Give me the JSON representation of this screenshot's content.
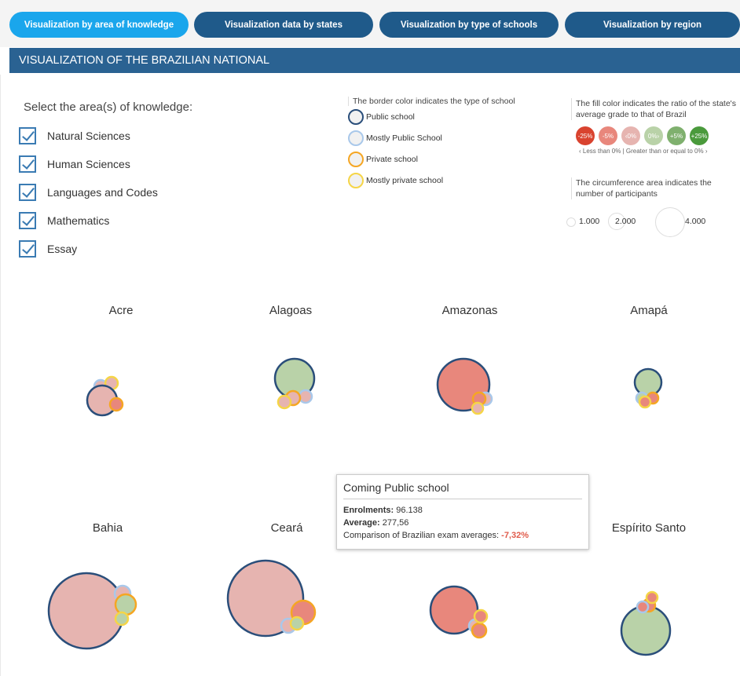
{
  "tabs": [
    {
      "label": "Visualization by area of knowledge",
      "active": true
    },
    {
      "label": "Visualization data by states",
      "active": false
    },
    {
      "label": "Visualization by type of schools",
      "active": false
    },
    {
      "label": "Visualization by region",
      "active": false
    }
  ],
  "banner": {
    "title": "VISUALIZATION OF THE BRAZILIAN NATIONAL"
  },
  "selector": {
    "title": "Select the area(s) of knowledge:",
    "items": [
      {
        "label": "Natural Sciences",
        "checked": true
      },
      {
        "label": "Human Sciences",
        "checked": true
      },
      {
        "label": "Languages and Codes",
        "checked": true
      },
      {
        "label": "Mathematics",
        "checked": true
      },
      {
        "label": "Essay",
        "checked": true
      }
    ]
  },
  "legend_border": {
    "title": "The border color indicates the type of school",
    "items": [
      {
        "label": "Public school",
        "color": "#2a4e7a"
      },
      {
        "label": "Mostly Public School",
        "color": "#a9c8ea"
      },
      {
        "label": "Private school",
        "color": "#f5a623"
      },
      {
        "label": "Mostly private school",
        "color": "#f5d547"
      }
    ]
  },
  "legend_fill": {
    "title": "The fill color indicates the ratio of the state's average grade to that of Brazil",
    "pills": [
      {
        "label": "-25%",
        "color": "#d9432f"
      },
      {
        "label": "-5%",
        "color": "#e8877c"
      },
      {
        "label": "‹0%",
        "color": "#e6b4b0"
      },
      {
        "label": "0%›",
        "color": "#b9d2a8"
      },
      {
        "label": "+5%",
        "color": "#7fb06e"
      },
      {
        "label": "+25%",
        "color": "#4a9a3c"
      }
    ],
    "note": "‹ Less than 0% | Greater than or equal to 0% ›",
    "size_title": "The circumference area indicates the number of participants",
    "sizes": [
      "1.000",
      "2.000",
      "4.000"
    ]
  },
  "colors": {
    "public": "#2a4e7a",
    "mostly_public": "#a9c8ea",
    "private": "#f5a623",
    "mostly_private": "#f5d547",
    "fill_neg_strong": "#e8877c",
    "fill_neg_light": "#e6b4b0",
    "fill_pos_light": "#b9d2a8"
  },
  "states": [
    {
      "name": "Acre",
      "bubbles": [
        {
          "type": "mostly_public",
          "fill": "fill_neg_light",
          "r": 8
        },
        {
          "type": "mostly_private",
          "fill": "fill_neg_light",
          "r": 8
        },
        {
          "type": "public",
          "fill": "fill_neg_light",
          "r": 19
        },
        {
          "type": "private",
          "fill": "fill_neg_strong",
          "r": 8
        }
      ]
    },
    {
      "name": "Alagoas",
      "bubbles": [
        {
          "type": "public",
          "fill": "fill_pos_light",
          "r": 25
        },
        {
          "type": "mostly_public",
          "fill": "fill_neg_light",
          "r": 8
        },
        {
          "type": "private",
          "fill": "fill_neg_light",
          "r": 9
        },
        {
          "type": "mostly_private",
          "fill": "fill_neg_light",
          "r": 8
        }
      ]
    },
    {
      "name": "Amazonas",
      "bubbles": [
        {
          "type": "public",
          "fill": "fill_neg_strong",
          "r": 33
        },
        {
          "type": "mostly_public",
          "fill": "fill_neg_light",
          "r": 8
        },
        {
          "type": "private",
          "fill": "fill_neg_strong",
          "r": 8
        },
        {
          "type": "mostly_private",
          "fill": "fill_neg_light",
          "r": 7
        }
      ]
    },
    {
      "name": "Amapá",
      "bubbles": [
        {
          "type": "public",
          "fill": "fill_pos_light",
          "r": 17
        },
        {
          "type": "mostly_public",
          "fill": "fill_pos_light",
          "r": 7
        },
        {
          "type": "private",
          "fill": "fill_neg_strong",
          "r": 7
        },
        {
          "type": "mostly_private",
          "fill": "fill_neg_strong",
          "r": 7
        }
      ]
    },
    {
      "name": "Bahia",
      "bubbles": [
        {
          "type": "public",
          "fill": "fill_neg_light",
          "r": 48
        },
        {
          "type": "mostly_public",
          "fill": "fill_neg_light",
          "r": 10
        },
        {
          "type": "private",
          "fill": "fill_pos_light",
          "r": 13
        },
        {
          "type": "mostly_private",
          "fill": "fill_pos_light",
          "r": 8
        }
      ]
    },
    {
      "name": "Ceará",
      "bubbles": [
        {
          "type": "public",
          "fill": "fill_neg_light",
          "r": 48
        },
        {
          "type": "private",
          "fill": "fill_neg_strong",
          "r": 15
        },
        {
          "type": "mostly_public",
          "fill": "fill_neg_light",
          "r": 9
        },
        {
          "type": "mostly_private",
          "fill": "fill_pos_light",
          "r": 8
        }
      ]
    },
    {
      "name": "",
      "bubbles": [
        {
          "type": "public",
          "fill": "fill_neg_strong",
          "r": 30
        },
        {
          "type": "mostly_public",
          "fill": "fill_neg_light",
          "r": 8
        },
        {
          "type": "private",
          "fill": "fill_neg_strong",
          "r": 9
        },
        {
          "type": "mostly_private",
          "fill": "fill_neg_strong",
          "r": 8
        }
      ]
    },
    {
      "name": "Espírito Santo",
      "bubbles": [
        {
          "type": "public",
          "fill": "fill_pos_light",
          "r": 31
        },
        {
          "type": "private",
          "fill": "fill_neg_strong",
          "r": 8
        },
        {
          "type": "mostly_public",
          "fill": "fill_neg_strong",
          "r": 7
        },
        {
          "type": "mostly_private",
          "fill": "fill_neg_strong",
          "r": 7
        }
      ]
    }
  ],
  "tooltip": {
    "title": "Coming Public school",
    "enrolments_label": "Enrolments:",
    "enrolments_value": "96.138",
    "average_label": "Average:",
    "average_value": "277,56",
    "comparison_label": "Comparison of Brazilian exam averages:",
    "comparison_value": "-7,32%"
  }
}
